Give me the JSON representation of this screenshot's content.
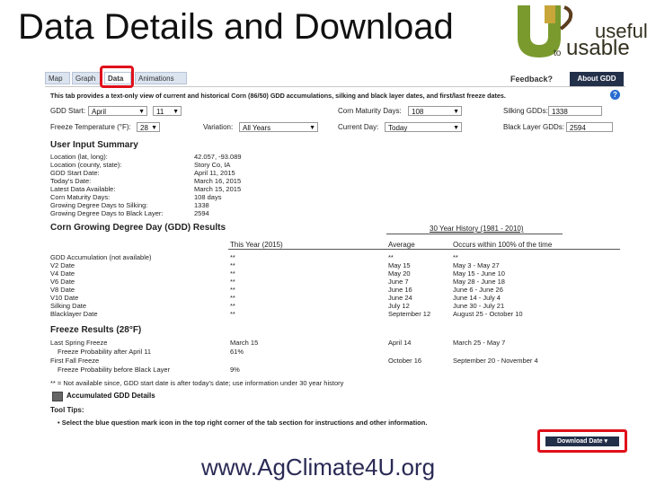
{
  "slide": {
    "title": "Data Details and Download",
    "footer_url": "www.AgClimate4U.org",
    "logo": {
      "useful": "useful",
      "to": "to",
      "usable": "usable"
    }
  },
  "app": {
    "tabs": [
      "Map",
      "Graph",
      "Data",
      "Animations"
    ],
    "feedback": "Feedback?",
    "about": "About GDD",
    "intro": "This tab provides a text-only view of current and historical Corn (86/50) GDD accumulations, silking and black layer dates, and first/last freeze dates.",
    "help": "?",
    "controls": {
      "gdd_start_label": "GDD Start:",
      "gdd_start_month": "April",
      "gdd_start_day": "11",
      "freeze_temp_label": "Freeze Temperature (°F):",
      "freeze_temp_value": "28",
      "variation_label": "Variation:",
      "variation_value": "All Years",
      "corn_maturity_label": "Corn Maturity Days:",
      "corn_maturity_value": "108",
      "current_day_label": "Current Day:",
      "current_day_value": "Today",
      "silking_label": "Silking GDDs:",
      "silking_value": "1338",
      "black_layer_label": "Black Layer GDDs:",
      "black_layer_value": "2594"
    },
    "summary": {
      "heading": "User Input Summary",
      "labels": [
        "Location (lat, long):",
        "Location (county, state):",
        "GDD Start Date:",
        "Today's Date:",
        "Latest Data Available:",
        "Corn Maturity Days:",
        "Growing Degree Days to Silking:",
        "Growing Degree Days to Black Layer:"
      ],
      "values": [
        "42.057, -93.089",
        "Story Co, IA",
        "April 11, 2015",
        "March 16, 2015",
        "March 15, 2015",
        "108 days",
        "1338",
        "2594"
      ]
    },
    "gdd_results": {
      "heading": "Corn Growing Degree Day (GDD) Results",
      "history_header": "30 Year History (1981 - 2010)",
      "col_this_year": "This Year (2015)",
      "col_average": "Average",
      "col_occurs": "Occurs within 100% of the time",
      "rows": [
        {
          "label": "GDD Accumulation (not available)",
          "this_year": "**",
          "average": "**",
          "range": "**"
        },
        {
          "label": "V2 Date",
          "this_year": "**",
          "average": "May 15",
          "range": "May 3 - May 27"
        },
        {
          "label": "V4 Date",
          "this_year": "**",
          "average": "May 20",
          "range": "May 15 - June 10"
        },
        {
          "label": "V6 Date",
          "this_year": "**",
          "average": "June 7",
          "range": "May 28 - June 18"
        },
        {
          "label": "V8 Date",
          "this_year": "**",
          "average": "June 16",
          "range": "June 6 - June 26"
        },
        {
          "label": "V10 Date",
          "this_year": "**",
          "average": "June 24",
          "range": "June 14 - July 4"
        },
        {
          "label": "Silking Date",
          "this_year": "**",
          "average": "July 12",
          "range": "June 30 - July 21"
        },
        {
          "label": "Blacklayer Date",
          "this_year": "**",
          "average": "September 12",
          "range": "August 25 - October 10"
        }
      ]
    },
    "freeze": {
      "heading": "Freeze Results (28°F)",
      "rows": [
        {
          "label": "Last Spring Freeze",
          "this_year": "March 15",
          "average": "April 14",
          "range": "March 25 - May 7"
        },
        {
          "label": "Freeze Probability after April 11",
          "this_year": "61%",
          "average": "",
          "range": ""
        },
        {
          "label": "First Fall Freeze",
          "this_year": "",
          "average": "October 16",
          "range": "September 20 - November 4"
        },
        {
          "label": "Freeze Probability before Black Layer",
          "this_year": "9%",
          "average": "",
          "range": ""
        }
      ]
    },
    "note": "** = Not available since, GDD start date is after today's date; use information under 30 year history",
    "accumulated_label": "Accumulated GDD Details",
    "tool_tips_heading": "Tool Tips:",
    "tool_tip": "Select the blue question mark icon in the top right corner of the tab section for instructions and other information.",
    "download_label": "Download Date ▾"
  }
}
